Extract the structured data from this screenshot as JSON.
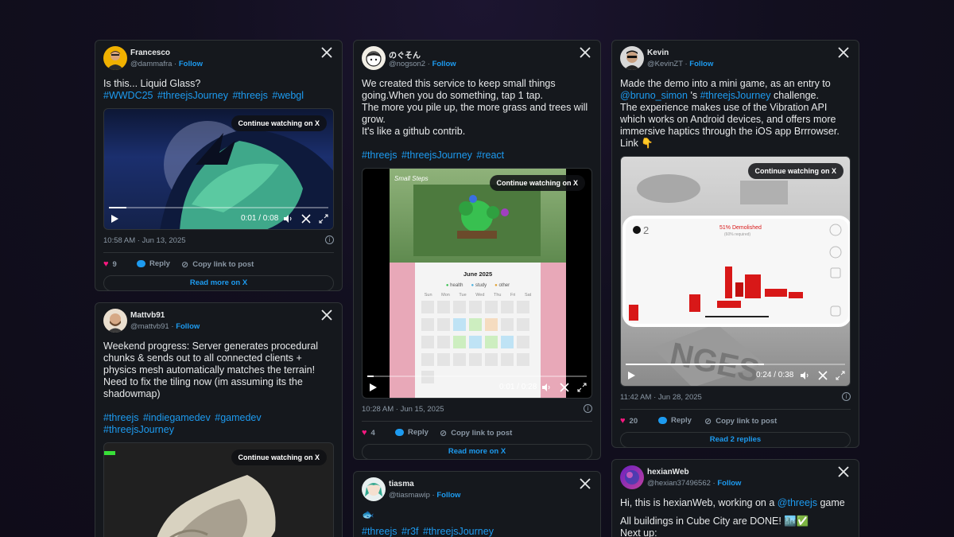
{
  "posts": [
    {
      "name": "Francesco",
      "handle": "@dammafra",
      "follow": "Follow",
      "text": "Is this... Liquid Glass?",
      "tags": [
        "#WWDC25",
        "#threejsJourney",
        "#threejs",
        "#webgl"
      ],
      "continue": "Continue watching on X",
      "video_time": "0:01 / 0:08",
      "date": "10:58 AM · Jun 13, 2025",
      "likes": "9",
      "reply": "Reply",
      "copy": "Copy link to post",
      "footer_btn": "Read more on X"
    },
    {
      "name": "のぐそん",
      "handle": "@nogson2",
      "follow": "Follow",
      "text": "We created this service to keep small things going.When you do something, tap 1 tap.\nThe more you pile up, the more grass and trees will grow.\nIt's like a github contrib.",
      "tags": [
        "#threejs",
        "#threejsJourney",
        "#react"
      ],
      "continue": "Continue watching on X",
      "video_time": "0:01 / 0:28",
      "app_title": "Small Steps",
      "calendar_month": "June 2025",
      "calendar_legend": [
        "health",
        "study",
        "other"
      ],
      "calendar_days": [
        "Sun",
        "Mon",
        "Tue",
        "Wed",
        "Thu",
        "Fri",
        "Sat"
      ],
      "date": "10:28 AM · Jun 15, 2025",
      "likes": "4",
      "reply": "Reply",
      "copy": "Copy link to post",
      "footer_btn": "Read more on X"
    },
    {
      "name": "Kevin",
      "handle": "@KevinZT",
      "follow": "Follow",
      "text_parts": [
        "Made the demo into a mini game, as an entry to ",
        "@bruno_simon",
        " 's ",
        "#threejsJourney",
        " challenge.\nThe experience makes use of the Vibration API which works on Android devices, and offers more immersive haptics through the iOS app Brrrowser.\nLink 👇"
      ],
      "continue": "Continue watching on X",
      "video_time": "0:24 / 0:38",
      "game_count": "2",
      "game_status": "51% Demolished",
      "game_sub": "(60% required)",
      "date": "11:42 AM · Jun 28, 2025",
      "likes": "20",
      "reply": "Reply",
      "copy": "Copy link to post",
      "footer_btn": "Read 2 replies"
    },
    {
      "name": "Mattvb91",
      "handle": "@mattvb91",
      "follow": "Follow",
      "text": "Weekend progress: Server generates procedural chunks & sends out to all connected clients + physics mesh automatically matches the terrain! Need to fix the tiling now (im assuming its the shadowmap)",
      "tags": [
        "#threejs",
        "#indiegamedev",
        "#gamedev",
        "#threejsJourney"
      ],
      "continue": "Continue watching on X"
    },
    {
      "name": "tiasma",
      "handle": "@tiasmawip",
      "follow": "Follow",
      "emoji": "🐟",
      "tags": [
        "#threejs",
        "#r3f",
        "#threejsJourney"
      ]
    },
    {
      "name": "hexianWeb",
      "handle": "@hexian37496562",
      "follow": "Follow",
      "text_a": "Hi, this is hexianWeb, working on a ",
      "text_mention": "@threejs",
      "text_b": " game",
      "text_c": "All buildings in Cube City are DONE! 🏙️✅",
      "text_d": "Next up:"
    }
  ],
  "colors": {
    "link": "#1d9bf0",
    "like": "#f91880",
    "bg": "#120f1f",
    "card": "#15181d"
  }
}
